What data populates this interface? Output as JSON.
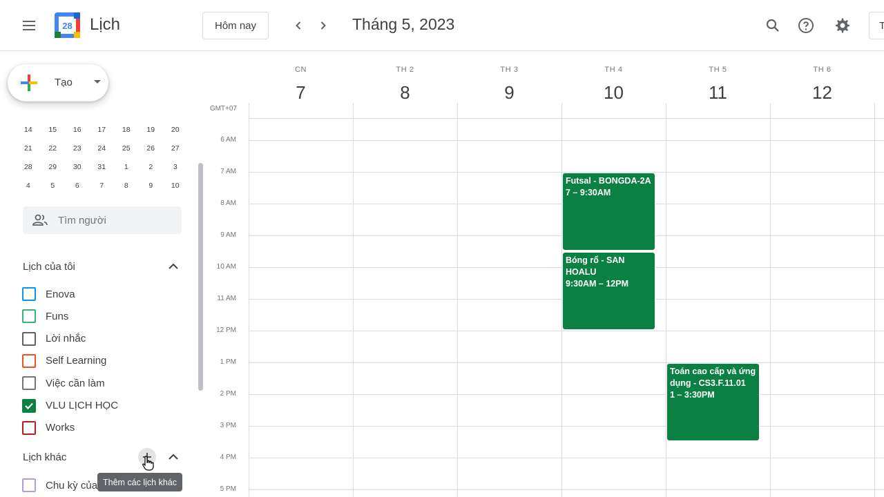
{
  "header": {
    "app_title": "Lịch",
    "logo_day": "28",
    "today_label": "Hôm nay",
    "month_title": "Tháng 5, 2023",
    "view_label": "T"
  },
  "sidebar": {
    "create_label": "Tạo",
    "mini_calendar": [
      [
        "14",
        "15",
        "16",
        "17",
        "18",
        "19",
        "20"
      ],
      [
        "21",
        "22",
        "23",
        "24",
        "25",
        "26",
        "27"
      ],
      [
        "28",
        "29",
        "30",
        "31",
        "1",
        "2",
        "3"
      ],
      [
        "4",
        "5",
        "6",
        "7",
        "8",
        "9",
        "10"
      ]
    ],
    "search_people_placeholder": "Tìm người",
    "my_calendars_title": "Lịch của tôi",
    "my_calendars": [
      {
        "name": "Enova",
        "color": "#039be5",
        "checked": false
      },
      {
        "name": "Funs",
        "color": "#33b679",
        "checked": false
      },
      {
        "name": "Lời nhắc",
        "color": "#616161",
        "checked": false
      },
      {
        "name": "Self Learning",
        "color": "#f4511e",
        "checked": false
      },
      {
        "name": "Việc cần làm",
        "color": "#757575",
        "checked": false
      },
      {
        "name": "VLU LỊCH HỌC",
        "color": "#0b8043",
        "checked": true
      },
      {
        "name": "Works",
        "color": "#b71c1c",
        "checked": false
      }
    ],
    "other_calendars_title": "Lịch khác",
    "other_calendars": [
      {
        "name": "Chu kỳ của",
        "color": "#b39ddb"
      }
    ],
    "add_other_tooltip": "Thêm các lịch khác"
  },
  "grid": {
    "timezone": "GMT+07",
    "days": [
      {
        "name": "CN",
        "num": "7"
      },
      {
        "name": "TH 2",
        "num": "8"
      },
      {
        "name": "TH 3",
        "num": "9"
      },
      {
        "name": "TH 4",
        "num": "10"
      },
      {
        "name": "TH 5",
        "num": "11"
      },
      {
        "name": "TH 6",
        "num": "12"
      }
    ],
    "hours": [
      "6 AM",
      "7 AM",
      "8 AM",
      "9 AM",
      "10 AM",
      "11 AM",
      "12 PM",
      "1 PM",
      "2 PM",
      "3 PM",
      "4 PM",
      "5 PM"
    ],
    "events": [
      {
        "title": "Futsal - BONGDA-2A",
        "time": "7 – 9:30AM",
        "day": "TH 4"
      },
      {
        "title": "Bóng rổ - SAN HOALU",
        "time": "9:30AM – 12PM",
        "day": "TH 4"
      },
      {
        "title": "Toán cao cấp và ứng dụng - CS3.F.11.01",
        "time": "1 – 3:30PM",
        "day": "TH 5"
      }
    ],
    "event_color": "#0b8043"
  }
}
